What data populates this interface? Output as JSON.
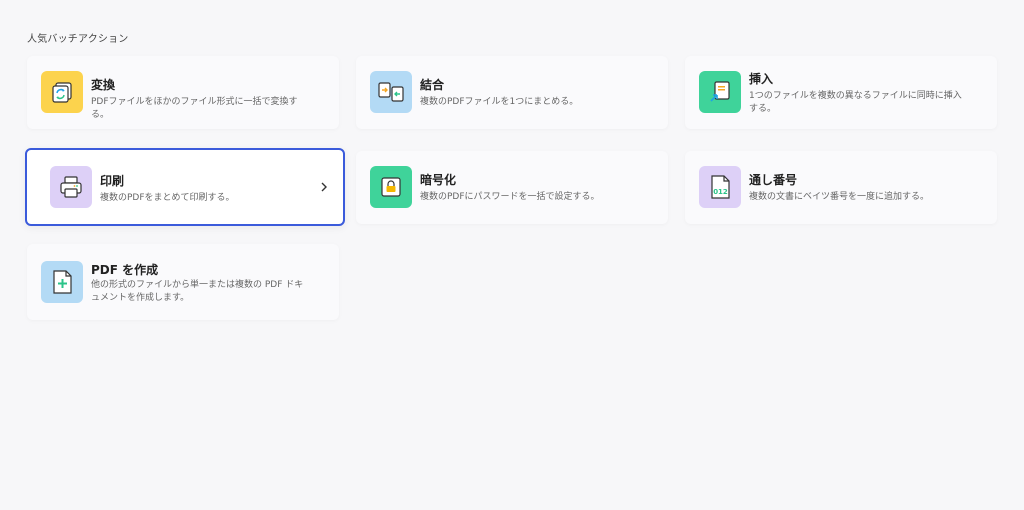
{
  "section_title": "人気バッチアクション",
  "cards": [
    {
      "title": "変換",
      "desc": "PDFファイルをほかのファイル形式に一括で変換する。",
      "icon": "convert-icon",
      "color": "#fcd34d"
    },
    {
      "title": "結合",
      "desc": "複数のPDFファイルを1つにまとめる。",
      "icon": "merge-icon",
      "color": "#b3daf5"
    },
    {
      "title": "挿入",
      "desc": "1つのファイルを複数の異なるファイルに同時に挿入する。",
      "icon": "insert-icon",
      "color": "#3fd39a"
    },
    {
      "title": "印刷",
      "desc": "複数のPDFをまとめて印刷する。",
      "icon": "printer-icon",
      "color": "#ddd0f7"
    },
    {
      "title": "暗号化",
      "desc": "複数のPDFにパスワードを一括で設定する。",
      "icon": "lock-icon",
      "color": "#3fd39a"
    },
    {
      "title": "通し番号",
      "desc": "複数の文書にベイツ番号を一度に追加する。",
      "icon": "bates-number-icon",
      "color": "#ddd0f7"
    },
    {
      "title": "PDF を作成",
      "desc": "他の形式のファイルから単一または複数の PDF ドキュメントを作成します。",
      "icon": "create-pdf-icon",
      "color": "#b3daf5"
    }
  ],
  "bates_icon_text": "012"
}
